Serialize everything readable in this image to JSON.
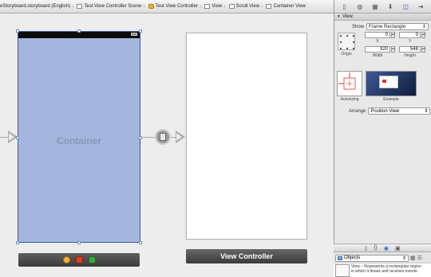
{
  "jumpbar": {
    "crumbs": [
      "eStoryboard.storyboard (English)",
      "Test View Controller Scene",
      "Test View Controller",
      "View",
      "Scroll View",
      "Container View"
    ]
  },
  "canvas": {
    "container_label": "Container",
    "view_controller_label": "View Controller"
  },
  "inspector": {
    "section_title": "View",
    "show_label": "Show",
    "show_value": "Frame Rectangle",
    "x_value": "0",
    "y_value": "0",
    "x_label": "X",
    "y_label": "Y",
    "width_value": "320",
    "height_value": "548",
    "width_label": "Width",
    "height_label": "Height",
    "origin_label": "Origin",
    "autosizing_label": "Autosizing",
    "example_label": "Example",
    "arrange_label": "Arrange",
    "arrange_value": "Position View"
  },
  "library": {
    "filter_value": "Objects",
    "item_description_line1": "View – Represents a rectangular region",
    "item_description_line2": "in which it draws and receives events."
  },
  "colors": {
    "container_fill": "#a4b6de",
    "container_border": "#3b5b9a",
    "accent_blue": "#2b62c8"
  }
}
